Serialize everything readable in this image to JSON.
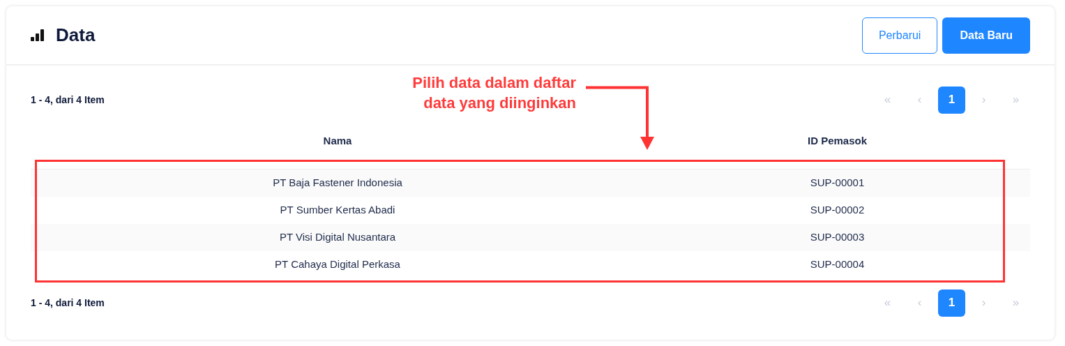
{
  "header": {
    "title": "Data",
    "buttons": [
      {
        "label": "Perbarui",
        "kind": "outline"
      },
      {
        "label": "Data Baru",
        "kind": "primary"
      }
    ]
  },
  "pagination_top": {
    "summary": "1 - 4, dari 4 Item",
    "items": [
      {
        "label": "«",
        "disabled": true,
        "selected": false
      },
      {
        "label": "‹",
        "disabled": true,
        "selected": false
      },
      {
        "label": "1",
        "disabled": false,
        "selected": true
      },
      {
        "label": "›",
        "disabled": true,
        "selected": false
      },
      {
        "label": "»",
        "disabled": true,
        "selected": false
      }
    ]
  },
  "table": {
    "columns": [
      "Nama",
      "ID Pemasok"
    ],
    "rows": [
      [
        "PT Baja Fastener Indonesia",
        "SUP-00001"
      ],
      [
        "PT Sumber Kertas Abadi",
        "SUP-00002"
      ],
      [
        "PT Visi Digital Nusantara",
        "SUP-00003"
      ],
      [
        "PT Cahaya Digital Perkasa",
        "SUP-00004"
      ]
    ]
  },
  "pagination_bottom": {
    "summary": "1 - 4, dari 4 Item",
    "items": [
      {
        "label": "«",
        "disabled": true,
        "selected": false
      },
      {
        "label": "‹",
        "disabled": true,
        "selected": false
      },
      {
        "label": "1",
        "disabled": false,
        "selected": true
      },
      {
        "label": "›",
        "disabled": true,
        "selected": false
      },
      {
        "label": "»",
        "disabled": true,
        "selected": false
      }
    ]
  },
  "annotation": {
    "lines": [
      "Pilih data dalam daftar",
      "data yang diinginkan"
    ]
  }
}
